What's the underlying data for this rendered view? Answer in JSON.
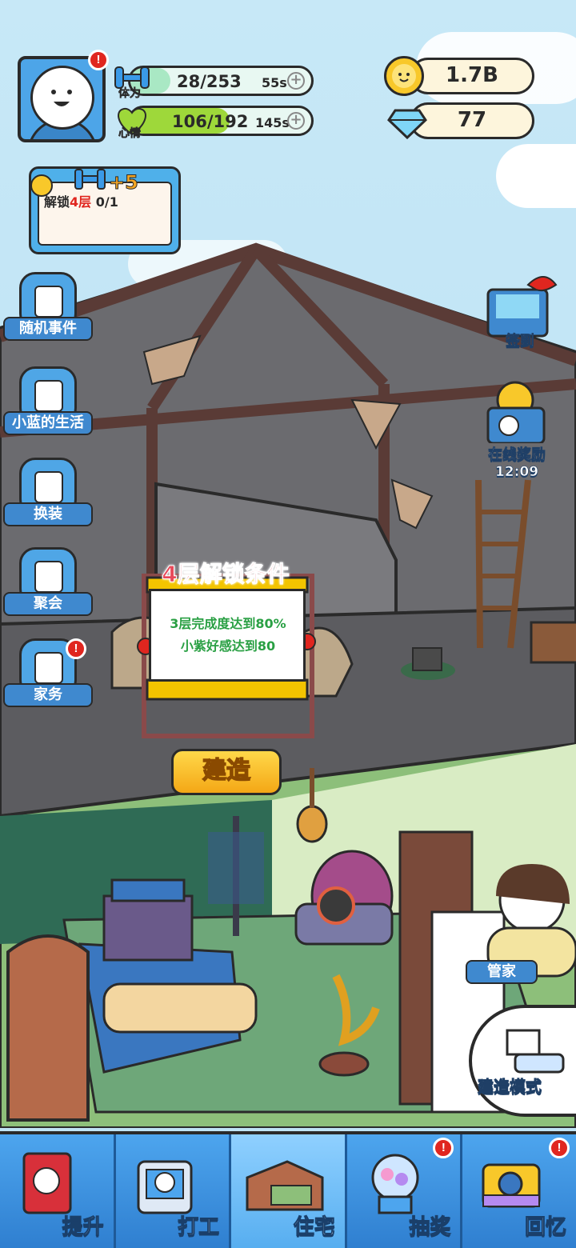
{
  "player": {
    "stamina_label": "体力",
    "stamina_value": "28/253",
    "stamina_timer": "55s",
    "stamina_fraction": 0.11,
    "mood_label": "心情",
    "mood_value": "106/192",
    "mood_timer": "145s",
    "mood_fraction": 0.55
  },
  "currency": {
    "gold": "1.7B",
    "diamonds": "77"
  },
  "quest": {
    "reward": "+5",
    "text_prefix": "解锁",
    "text_highlight": "4层",
    "progress": "0/1"
  },
  "left_menu": [
    {
      "label": "随机事件",
      "icon": "event-icon"
    },
    {
      "label": "小蓝的生活",
      "icon": "life-icon"
    },
    {
      "label": "换装",
      "icon": "shirt-icon"
    },
    {
      "label": "聚会",
      "icon": "party-icon"
    },
    {
      "label": "家务",
      "icon": "vacuum-icon"
    }
  ],
  "right_menu": {
    "checkin_label": "签到",
    "online_reward_label": "在线奖励",
    "online_reward_timer": "12:09"
  },
  "unlock_sign": {
    "title": "4层解锁条件",
    "condition_1": "3层完成度达到80%",
    "condition_2": "小紫好感达到80"
  },
  "build_button": "建造",
  "steward_label": "管家",
  "build_mode_label": "建造模式",
  "nav": [
    {
      "label": "提升",
      "icon": "book-icon"
    },
    {
      "label": "打工",
      "icon": "work-badge-icon"
    },
    {
      "label": "住宅",
      "icon": "house-icon"
    },
    {
      "label": "抽奖",
      "icon": "gacha-icon"
    },
    {
      "label": "回忆",
      "icon": "camera-icon"
    }
  ],
  "colors": {
    "accent_blue": "#3f89cf",
    "stamina_green": "#a9e8c4",
    "mood_green": "#9ed83a",
    "alert_red": "#e0261f",
    "sign_title": "#e84a5a",
    "condition_green": "#2aa044",
    "build_yellow": "#f4a716"
  }
}
